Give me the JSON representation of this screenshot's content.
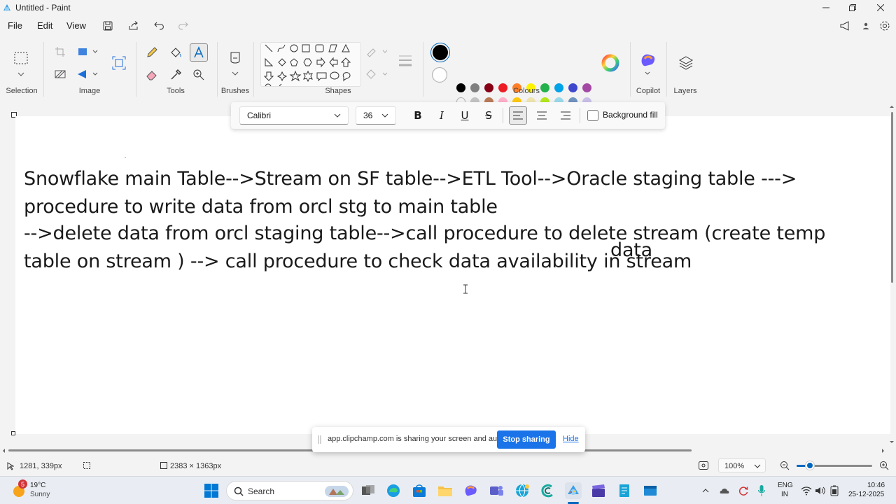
{
  "window": {
    "title": "Untitled - Paint"
  },
  "menu": {
    "file": "File",
    "edit": "Edit",
    "view": "View"
  },
  "ribbon": {
    "groups": {
      "selection": "Selection",
      "image": "Image",
      "tools": "Tools",
      "brushes": "Brushes",
      "shapes": "Shapes",
      "colours": "Colours",
      "copilot": "Copilot",
      "layers": "Layers"
    },
    "palette_row1": [
      "#000000",
      "#7f7f7f",
      "#880015",
      "#ed1c24",
      "#ff7f27",
      "#fff200",
      "#22b14c",
      "#00a2e8",
      "#3f48cc",
      "#a349a4"
    ],
    "palette_row2": [
      "",
      "#c3c3c3",
      "#b97a57",
      "#ffaec9",
      "#ffc90e",
      "#efe4b0",
      "#b5e61d",
      "#99d9ea",
      "#7092be",
      "#c8bfe7"
    ],
    "primary_colour": "#000000",
    "secondary_colour": "#ffffff"
  },
  "text_toolbar": {
    "font": "Calibri",
    "size": "36",
    "bold": "B",
    "italic": "I",
    "underline": "U",
    "strike": "S",
    "background_fill": "Background fill"
  },
  "canvas": {
    "lines": [
      "Snowflake main Table-->Stream on SF table-->ETL Tool-->Oracle staging table --->",
      "procedure to write data from orcl stg to main table",
      "-->delete data from orcl staging table-->call procedure to delete stream (create temp",
      "table on stream ) --> call procedure to check data availability in stream"
    ],
    "overlay_word": "data"
  },
  "sharebar": {
    "message": "app.clipchamp.com is sharing your screen and audio.",
    "stop": "Stop sharing",
    "hide": "Hide"
  },
  "status": {
    "cursor_pos": "1281, 339px",
    "canvas_size": "2383 × 1363px",
    "zoom": "100%"
  },
  "taskbar": {
    "weather_temp": "19°C",
    "weather_desc": "Sunny",
    "weather_badge": "5",
    "search": "Search",
    "lang1": "ENG",
    "lang2": "IN",
    "time": "10:46",
    "date": "25-12-2025"
  },
  "colors": {
    "accent": "#0067c0",
    "stop_button": "#1a73e8"
  }
}
